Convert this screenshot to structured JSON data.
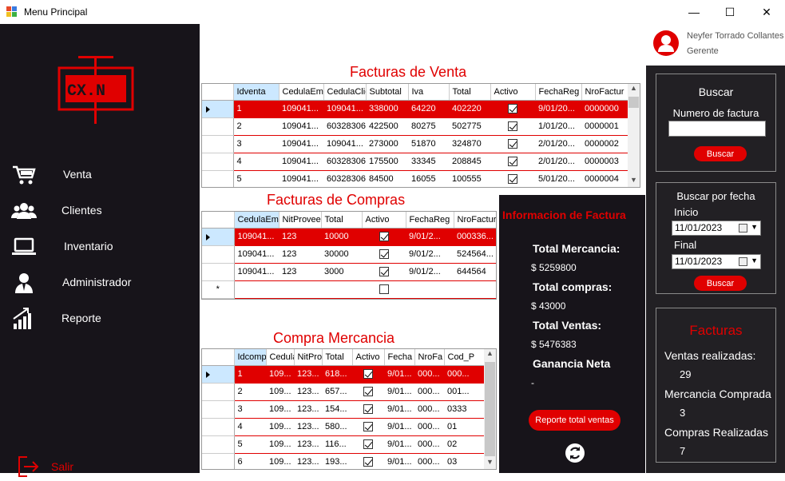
{
  "window": {
    "title": "Menu Principal",
    "minimize": "—",
    "maximize": "☐",
    "close": "✕"
  },
  "logo_text": "CX.N",
  "nav": [
    {
      "label": "Venta",
      "icon": "cart-icon"
    },
    {
      "label": "Clientes",
      "icon": "users-icon"
    },
    {
      "label": "Inventario",
      "icon": "laptop-icon"
    },
    {
      "label": "Administrador",
      "icon": "admin-icon"
    },
    {
      "label": "Reporte",
      "icon": "chart-icon"
    }
  ],
  "salir": "Salir",
  "user": {
    "name": "Neyfer Torrado Collantes",
    "role": "Gerente"
  },
  "ventas": {
    "title": "Facturas de Venta",
    "columns": [
      "Idventa",
      "CedulaEm",
      "CedulaClie",
      "Subtotal",
      "Iva",
      "Total",
      "Activo",
      "FechaReg",
      "NroFactur"
    ],
    "rows": [
      [
        "1",
        "109041...",
        "109041...",
        "338000",
        "64220",
        "402220",
        true,
        "9/01/20...",
        "0000000"
      ],
      [
        "2",
        "109041...",
        "60328306",
        "422500",
        "80275",
        "502775",
        true,
        "1/01/20...",
        "0000001"
      ],
      [
        "3",
        "109041...",
        "109041...",
        "273000",
        "51870",
        "324870",
        true,
        "2/01/20...",
        "0000002"
      ],
      [
        "4",
        "109041...",
        "60328306",
        "175500",
        "33345",
        "208845",
        true,
        "2/01/20...",
        "0000003"
      ],
      [
        "5",
        "109041...",
        "60328306",
        "84500",
        "16055",
        "100555",
        true,
        "5/01/20...",
        "0000004"
      ]
    ]
  },
  "compras": {
    "title": "Facturas de Compras",
    "columns": [
      "CedulaEm",
      "NitProvee",
      "Total",
      "Activo",
      "FechaReg",
      "NroFactur"
    ],
    "rows": [
      [
        "109041...",
        "123",
        "10000",
        true,
        "9/01/2...",
        "000336..."
      ],
      [
        "109041...",
        "123",
        "30000",
        true,
        "9/01/2...",
        "524564..."
      ],
      [
        "109041...",
        "123",
        "3000",
        true,
        "9/01/2...",
        "644564"
      ]
    ],
    "new_row_marker": "*"
  },
  "mercancia": {
    "title": "Compra Mercancia",
    "columns": [
      "Idcomp",
      "Cedula",
      "NitProv",
      "Total",
      "Activo",
      "Fecha",
      "NroFa",
      "Cod_P"
    ],
    "rows": [
      [
        "1",
        "109...",
        "123...",
        "618...",
        true,
        "9/01...",
        "000...",
        "000..."
      ],
      [
        "2",
        "109...",
        "123...",
        "657...",
        true,
        "9/01...",
        "000...",
        "001..."
      ],
      [
        "3",
        "109...",
        "123...",
        "154...",
        true,
        "9/01...",
        "000...",
        "0333"
      ],
      [
        "4",
        "109...",
        "123...",
        "580...",
        true,
        "9/01...",
        "000...",
        "01"
      ],
      [
        "5",
        "109...",
        "123...",
        "116...",
        true,
        "9/01...",
        "000...",
        "02"
      ],
      [
        "6",
        "109...",
        "123...",
        "193...",
        true,
        "9/01...",
        "000...",
        "03"
      ]
    ]
  },
  "info": {
    "title": "Informacion de Factura",
    "mercancia_label": "Total Mercancia:",
    "mercancia_value": "$ 5259800",
    "compras_label": "Total compras:",
    "compras_value": "$ 43000",
    "ventas_label": "Total Ventas:",
    "ventas_value": "$ 5476383",
    "ganancia_label": "Ganancia Neta",
    "ganancia_value": "-",
    "report_button": "Reporte total ventas"
  },
  "buscar": {
    "title": "Buscar",
    "label": "Numero de factura",
    "input_value": "",
    "button": "Buscar"
  },
  "buscar_fecha": {
    "title": "Buscar por fecha",
    "inicio_label": "Inicio",
    "inicio_value": "11/01/2023",
    "final_label": "Final",
    "final_value": "11/01/2023",
    "button": "Buscar"
  },
  "facturas": {
    "title": "Facturas",
    "ventas_label": "Ventas realizadas:",
    "ventas_value": "29",
    "mercancia_label": "Mercancia Comprada",
    "mercancia_value": "3",
    "compras_label": "Compras Realizadas",
    "compras_value": "7"
  },
  "colors": {
    "accent": "#e00000",
    "sidebar": "#17141a",
    "panel": "#222024",
    "selection": "#cce8ff"
  }
}
